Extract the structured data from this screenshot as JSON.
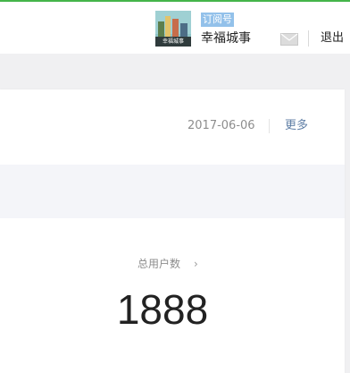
{
  "header": {
    "account_type": "订阅号",
    "account_name": "幸福城事",
    "avatar_caption": "幸福城事",
    "logout_label": "退出",
    "accent_color": "#44b549"
  },
  "card": {
    "date": "2017-06-06",
    "more_label": "更多",
    "stat": {
      "label": "总用户数",
      "value": "1888"
    }
  }
}
